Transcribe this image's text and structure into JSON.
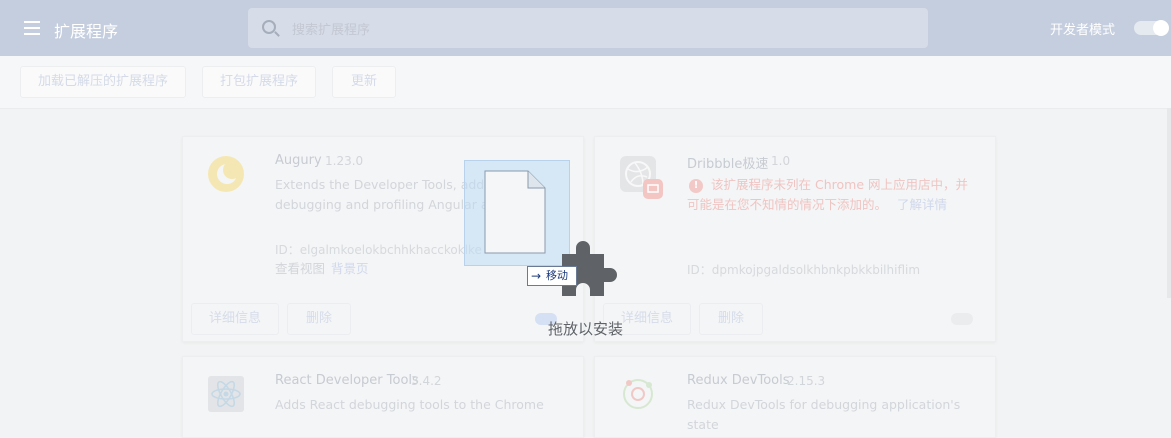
{
  "header": {
    "title": "扩展程序",
    "search_placeholder": "搜索扩展程序",
    "dev_mode_label": "开发者模式",
    "dev_mode_on": true
  },
  "toolbar": {
    "load_unpacked": "加载已解压的扩展程序",
    "pack": "打包扩展程序",
    "update": "更新"
  },
  "cards": [
    {
      "name": "Augury",
      "version": "1.23.0",
      "desc_line1": "Extends the Developer Tools, adding",
      "desc_line2": "debugging and profiling Angular appl",
      "id": "ID：elgalmkoelokbchhkhacckoklke",
      "inspect_label": "查看视图",
      "inspect_link": "背景页",
      "details": "详细信息",
      "remove": "删除"
    },
    {
      "name": "Dribbble极速",
      "version": "1.0",
      "warning_line1": "该扩展程序未列在 Chrome 网上应用店中，并",
      "warning_line2": "可能是在您不知情的情况下添加的。",
      "learn_more": "了解详情",
      "id": "ID：dpmkojpgaldsolkhbnkpbkkbilhiflim",
      "details": "详细信息",
      "remove": "删除"
    },
    {
      "name": "React Developer Tools",
      "version": "3.4.2",
      "desc_line1": "Adds React debugging tools to the Chrome"
    },
    {
      "name": "Redux DevTools",
      "version": "2.15.3",
      "desc_line1": "Redux DevTools for debugging application's state"
    }
  ],
  "drag": {
    "move_label": "移动",
    "drop_text": "拖放以安装"
  },
  "colors": {
    "header_bg": "#c5cede",
    "accent": "#1a73e8",
    "warning": "#d93025"
  }
}
